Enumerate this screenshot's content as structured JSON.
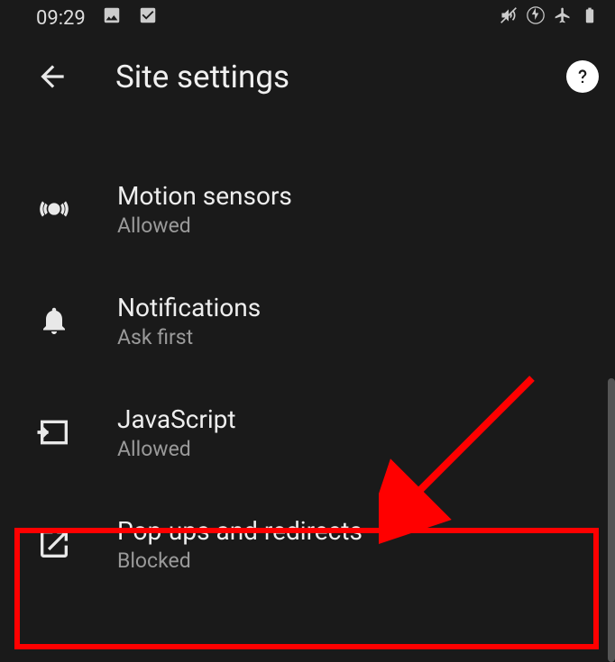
{
  "status_bar": {
    "time": "09:29",
    "icons": [
      "image-icon",
      "checkbox-icon",
      "mute-icon",
      "battery-saver-icon",
      "airplane-icon",
      "battery-icon"
    ]
  },
  "app_bar": {
    "title": "Site settings"
  },
  "settings": [
    {
      "icon": "motion-sensors-icon",
      "title": "Motion sensors",
      "subtitle": "Allowed"
    },
    {
      "icon": "notifications-icon",
      "title": "Notifications",
      "subtitle": "Ask first"
    },
    {
      "icon": "javascript-icon",
      "title": "JavaScript",
      "subtitle": "Allowed"
    },
    {
      "icon": "popups-icon",
      "title": "Pop-ups and redirects",
      "subtitle": "Blocked"
    }
  ],
  "annotation": {
    "highlighted_index": 3,
    "color": "#ff0000"
  }
}
